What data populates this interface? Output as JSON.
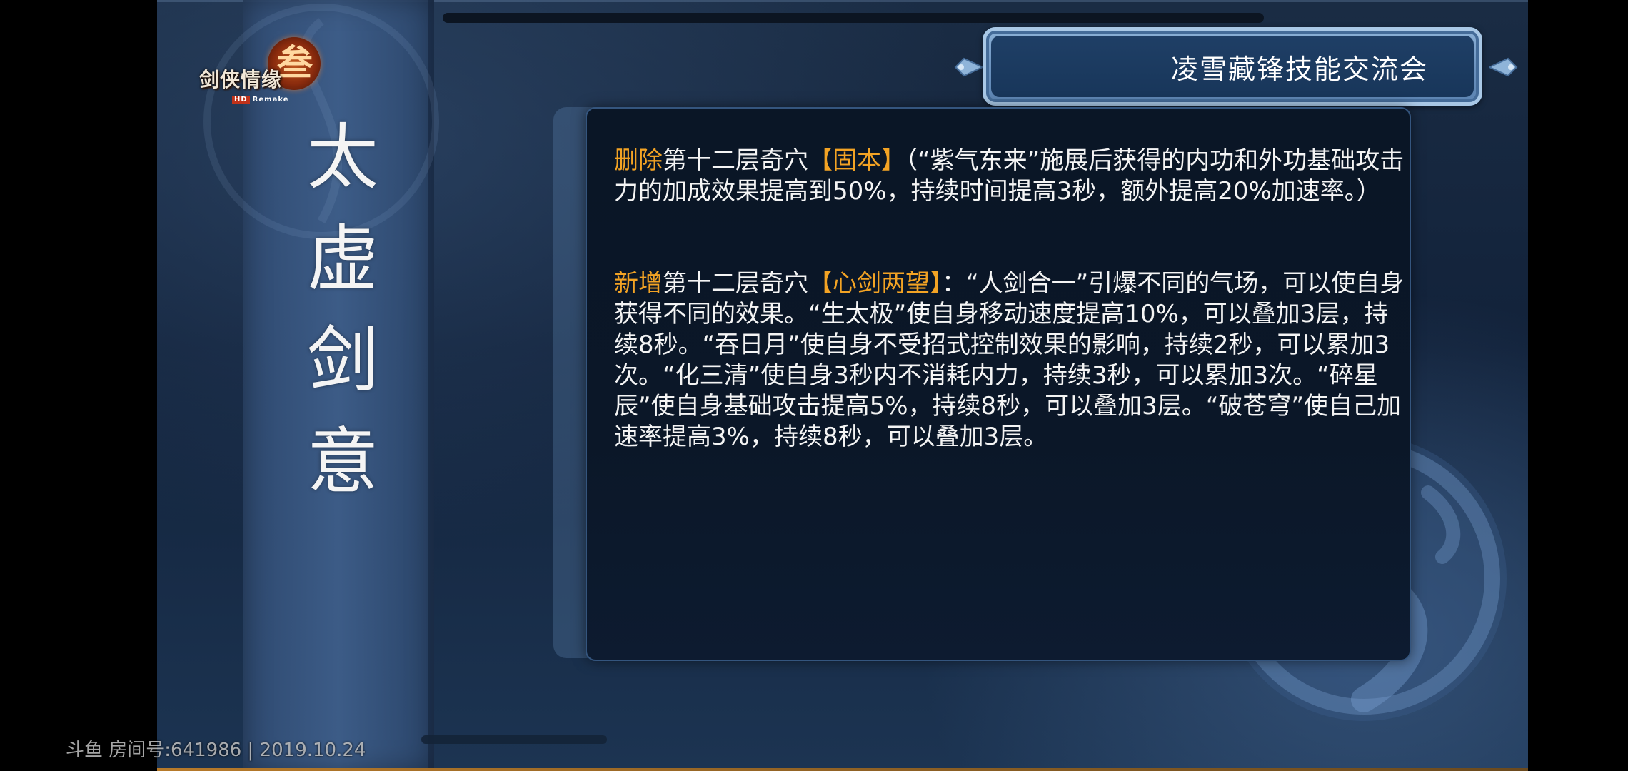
{
  "logo": {
    "text": "剑侠情缘",
    "emblem_char": "叁",
    "hd_badge": "HD",
    "remake_text": "Remake"
  },
  "banner": {
    "title": "凌雪藏锋技能交流会"
  },
  "vertical_title": {
    "chars": [
      "太",
      "虚",
      "剑",
      "意"
    ]
  },
  "panel": {
    "para1": {
      "action": "删除",
      "prefix": "第十二层奇穴",
      "name": "【固本】",
      "body": "（“紫气东来”施展后获得的内功和外功基础攻击力的加成效果提高到50%，持续时间提高3秒，额外提高20%加速率。）"
    },
    "para2": {
      "action": "新增",
      "prefix": "第十二层奇穴",
      "name": "【心剑两望】",
      "body": "：“人剑合一”引爆不同的气场，可以使自身获得不同的效果。“生太极”使自身移动速度提高10%，可以叠加3层，持续8秒。“吞日月”使自身不受招式控制效果的影响，持续2秒，可以累加3次。“化三清”使自身3秒内不消耗内力，持续3秒，可以累加3次。“碎星辰”使自身基础攻击提高5%，持续8秒，可以叠加3层。“破苍穹”使自己加速率提高3%，持续8秒，可以叠加3层。"
    }
  },
  "watermark": {
    "text": "斗鱼 房间号:641986 | 2019.10.24"
  },
  "colors": {
    "highlight": "#f3a324",
    "text": "#f4f4f4",
    "panel_bg": "#0a1626",
    "banner_border": "#8fb4d9"
  }
}
